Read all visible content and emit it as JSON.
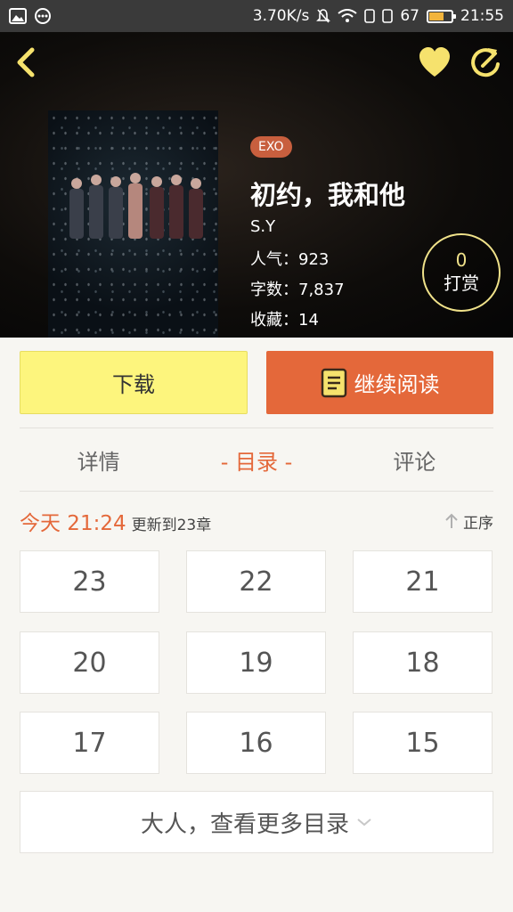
{
  "status_bar": {
    "speed": "3.70K/s",
    "battery": "67",
    "time": "21:55"
  },
  "book": {
    "tag": "EXO",
    "title": "初约，我和他",
    "author": "S.Y",
    "popularity": "人气：923",
    "word_count": "字数：7,837",
    "favorites": "收藏：14"
  },
  "reward": {
    "count": "0",
    "label": "打赏"
  },
  "actions": {
    "download": "下载",
    "continue_reading": "继续阅读"
  },
  "tabs": [
    {
      "label": "详情"
    },
    {
      "label": "- 目录 -"
    },
    {
      "label": "评论"
    }
  ],
  "update": {
    "time": "今天 21:24",
    "text": "更新到23章",
    "sort": "正序"
  },
  "chapters": [
    "23",
    "22",
    "21",
    "20",
    "19",
    "18",
    "17",
    "16",
    "15"
  ],
  "more": {
    "label": "大人，查看更多目录"
  },
  "colors": {
    "accent": "#e4683a",
    "yellow_button": "#fdf57d",
    "icon_yellow": "#f6e26d"
  }
}
